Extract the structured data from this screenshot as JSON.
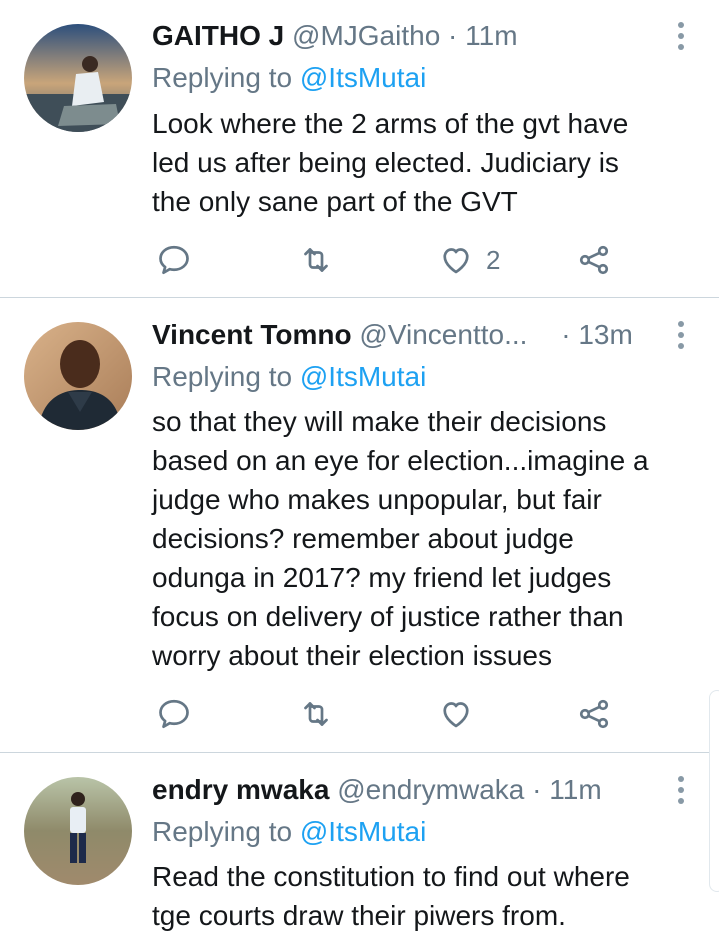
{
  "tweets": [
    {
      "name": "GAITHO J",
      "handle": "@MJGaitho",
      "dot": "·",
      "time": "11m",
      "replying_prefix": "Replying to ",
      "replying_to": "@ItsMutai",
      "text_lines": [
        "Look where the 2 arms of the gvt have",
        "led us after being elected.  Judiciary is",
        "the only sane part of the GVT"
      ],
      "like_count": "2"
    },
    {
      "name": "Vincent Tomno",
      "handle": "@Vincentto...",
      "dot": "·",
      "time": "13m",
      "replying_prefix": "Replying to ",
      "replying_to": "@ItsMutai",
      "text_lines": [
        "so that they will make their decisions",
        "based on an eye for election...imagine a",
        "judge who makes unpopular, but fair",
        "decisions? remember about judge",
        "odunga in 2017? my friend let judges",
        "focus on delivery of justice rather than",
        "worry about their election issues"
      ],
      "like_count": ""
    },
    {
      "name": "endry mwaka",
      "handle": "@endrymwaka",
      "dot": "·",
      "time": "11m",
      "replying_prefix": "Replying to ",
      "replying_to": "@ItsMutai",
      "text_lines": [
        "Read the constitution to find out where",
        "tge courts draw their piwers from."
      ],
      "like_count": ""
    }
  ],
  "colors": {
    "link": "#1da1f2",
    "muted": "#657786",
    "text": "#14171a",
    "divider": "#ccd6dd"
  },
  "icons": [
    "reply-icon",
    "retweet-icon",
    "like-icon",
    "share-icon",
    "more-options-icon"
  ]
}
